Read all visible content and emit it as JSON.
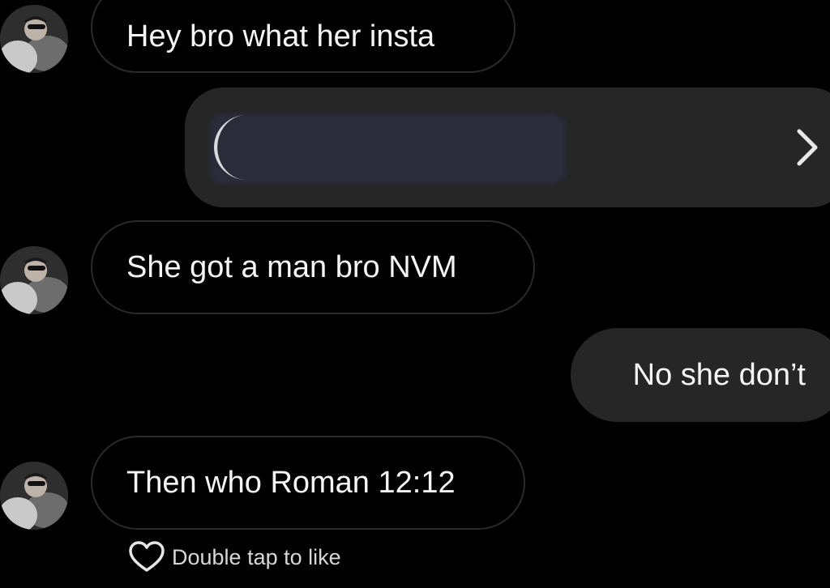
{
  "messages": [
    {
      "sender": "them",
      "text": "Hey bro what her insta"
    },
    {
      "sender": "them",
      "type": "shared_post"
    },
    {
      "sender": "them",
      "text": "She got a man bro NVM"
    },
    {
      "sender": "me",
      "text": "No she don’t"
    },
    {
      "sender": "them",
      "text": "Then who Roman 12:12"
    }
  ],
  "like_hint": "Double tap to like",
  "icons": {
    "avatar": "avatar",
    "share_preview": "crescent-icon",
    "share_open": "chevron-right-icon",
    "like": "heart-outline-icon"
  },
  "colors": {
    "background": "#000000",
    "outgoing_bubble": "#262626",
    "incoming_border": "#2a2a2a",
    "text": "#f5f5f5"
  }
}
